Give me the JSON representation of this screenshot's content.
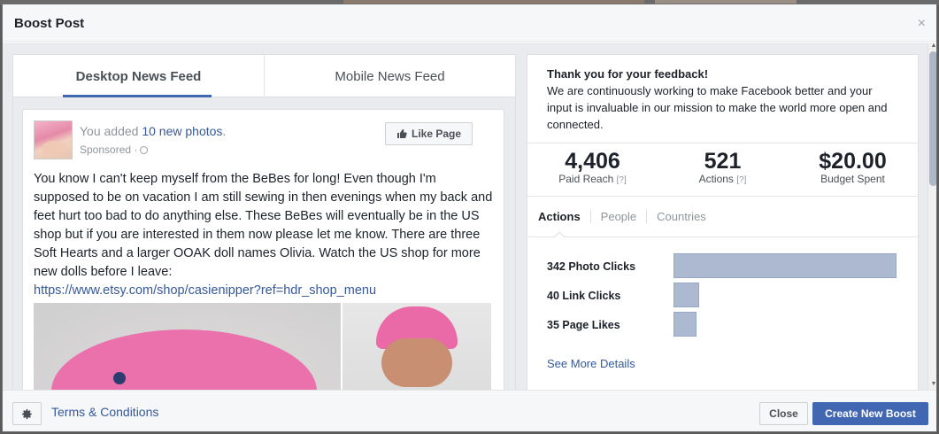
{
  "dialog": {
    "title": "Boost Post",
    "close_icon": "×"
  },
  "preview": {
    "tabs": [
      {
        "label": "Desktop News Feed",
        "active": true
      },
      {
        "label": "Mobile News Feed",
        "active": false
      }
    ],
    "post": {
      "line_prefix": "You added ",
      "line_link": "10 new photos",
      "line_suffix": ".",
      "sponsored": "Sponsored ·",
      "like_button": "Like Page",
      "text": "You know I can't keep myself from the BeBes for long! Even though I'm supposed to be on vacation I am still sewing in then evenings when my back and feet hurt too bad to do anything else. These BeBes will eventually be in the US shop but if you are interested in them now please let me know. There are three Soft Hearts and a larger OOAK doll names Olivia. Watch the US shop for more new dolls before I leave:",
      "url": "https://www.etsy.com/shop/casienipper?ref=hdr_shop_menu"
    }
  },
  "results": {
    "feedback_title": "Thank you for your feedback!",
    "feedback_text": "We are continuously working to make Facebook better and your input is invaluable in our mission to make the world more open and connected.",
    "stats": [
      {
        "value": "4,406",
        "label": "Paid Reach",
        "help": "[?]"
      },
      {
        "value": "521",
        "label": "Actions",
        "help": "[?]"
      },
      {
        "value": "$20.00",
        "label": "Budget Spent",
        "help": ""
      }
    ],
    "tabs": [
      "Actions",
      "People",
      "Countries"
    ],
    "actions": [
      {
        "label": "342 Photo Clicks",
        "count": 342
      },
      {
        "label": "40 Link Clicks",
        "count": 40
      },
      {
        "label": "35 Page Likes",
        "count": 35
      }
    ],
    "see_more": "See More Details"
  },
  "footer": {
    "terms": "Terms & Conditions",
    "close": "Close",
    "create_boost": "Create New Boost"
  },
  "colors": {
    "accent": "#4267b2",
    "link": "#365899",
    "bar": "#adb9d1"
  },
  "icons": {
    "gear": "gear-icon",
    "thumbs_up": "thumbs-up-icon",
    "globe": "globe-icon"
  }
}
